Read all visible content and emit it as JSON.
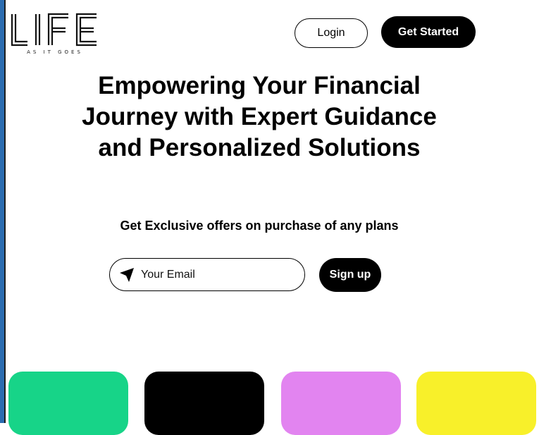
{
  "brand": {
    "logo_text": "LIFE",
    "tagline": "AS IT GOES"
  },
  "header": {
    "login_label": "Login",
    "get_started_label": "Get Started"
  },
  "hero": {
    "title": "Empowering Your Financial Journey with Expert Guidance and Personalized Solutions",
    "subtitle": "Get Exclusive offers on purchase of any plans"
  },
  "signup": {
    "email_placeholder": "Your Email",
    "email_value": "",
    "button_label": "Sign up",
    "icon": "send-arrow-icon"
  },
  "cards": [
    {
      "color": "#17d488"
    },
    {
      "color": "#000000"
    },
    {
      "color": "#e284f0"
    },
    {
      "color": "#f8f02a"
    }
  ],
  "colors": {
    "primary": "#000000",
    "background": "#ffffff",
    "left_edge": "#2b6cb0"
  }
}
